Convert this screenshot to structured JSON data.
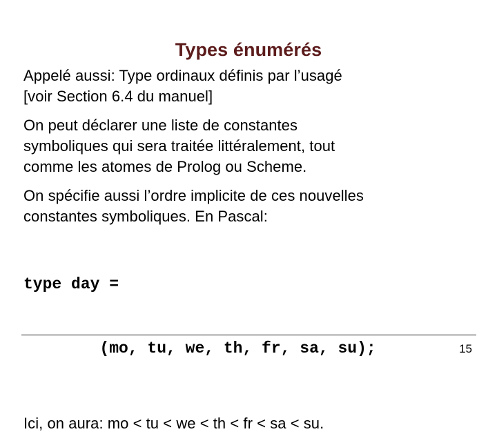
{
  "slide": {
    "title": "Types énumérés",
    "title_color": "#5c1b1b",
    "background_color": "#ffffff",
    "text_color": "#000000",
    "paragraphs": [
      {
        "id": "definition",
        "lines": [
          "Appelé aussi: Type ordinaux définis par l’usagé",
          "[voir Section 6.4 du manuel]"
        ]
      },
      {
        "id": "declaration",
        "lines": [
          "On peut déclarer une liste de constantes",
          "symboliques qui sera traitée littéralement, tout",
          "comme les atomes de Prolog ou Scheme."
        ]
      },
      {
        "id": "ordering",
        "lines": [
          "On spécifie aussi l’ordre implicite de ces nouvelles",
          "constantes symboliques.  En Pascal:"
        ]
      }
    ],
    "code": {
      "language": "Pascal",
      "lines": [
        "type day =",
        "        (mo, tu, we, th, fr, sa, su);"
      ]
    },
    "conclusion": {
      "id": "ordering-result",
      "lines": [
        "Ici, on aura: mo < tu < we < th < fr < sa < su."
      ]
    },
    "footer": {
      "page_number": "15"
    }
  }
}
